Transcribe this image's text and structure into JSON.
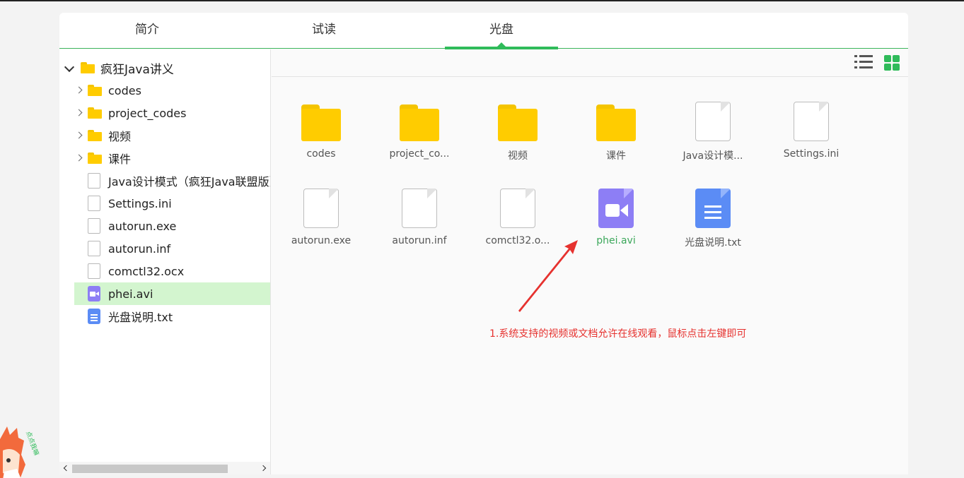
{
  "tabs": [
    {
      "label": "简介",
      "active": false
    },
    {
      "label": "试读",
      "active": false
    },
    {
      "label": "光盘",
      "active": true
    }
  ],
  "tree": {
    "root": {
      "label": "疯狂Java讲义",
      "icon": "folder-icon",
      "expanded": true
    },
    "items": [
      {
        "label": "codes",
        "icon": "folder-icon",
        "expandable": true
      },
      {
        "label": "project_codes",
        "icon": "folder-icon",
        "expandable": true
      },
      {
        "label": "视频",
        "icon": "folder-icon",
        "expandable": true
      },
      {
        "label": "课件",
        "icon": "folder-icon",
        "expandable": true
      },
      {
        "label": "Java设计模式（疯狂Java联盟版）",
        "icon": "file-icon"
      },
      {
        "label": "Settings.ini",
        "icon": "file-icon"
      },
      {
        "label": "autorun.exe",
        "icon": "file-icon"
      },
      {
        "label": "autorun.inf",
        "icon": "file-icon"
      },
      {
        "label": "comctl32.ocx",
        "icon": "file-icon"
      },
      {
        "label": "phei.avi",
        "icon": "video-file-icon",
        "selected": true
      },
      {
        "label": "光盘说明.txt",
        "icon": "document-file-icon"
      }
    ]
  },
  "grid": {
    "items": [
      {
        "label": "codes",
        "icon": "folder-icon"
      },
      {
        "label": "project_co...",
        "icon": "folder-icon"
      },
      {
        "label": "视频",
        "icon": "folder-icon"
      },
      {
        "label": "课件",
        "icon": "folder-icon"
      },
      {
        "label": "Java设计模...",
        "icon": "file-icon"
      },
      {
        "label": "Settings.ini",
        "icon": "file-icon"
      },
      {
        "label": "autorun.exe",
        "icon": "file-icon"
      },
      {
        "label": "autorun.inf",
        "icon": "file-icon"
      },
      {
        "label": "comctl32.o...",
        "icon": "file-icon"
      },
      {
        "label": "phei.avi",
        "icon": "video-file-icon"
      },
      {
        "label": "光盘说明.txt",
        "icon": "document-file-icon"
      }
    ]
  },
  "toolbar": {
    "list_view_icon": "list-view-icon",
    "grid_view_icon": "grid-view-icon"
  },
  "annotation": "1.系统支持的视频或文档允许在线观看，鼠标点击左键即可",
  "mascot_text": "点点我嘛",
  "colors": {
    "accent": "#2fbb5a",
    "folder": "#ffcc00",
    "video": "#8d7ef5",
    "document": "#5b8cf5",
    "selected_row": "#d3f5cf",
    "annotation": "#e6322f"
  }
}
